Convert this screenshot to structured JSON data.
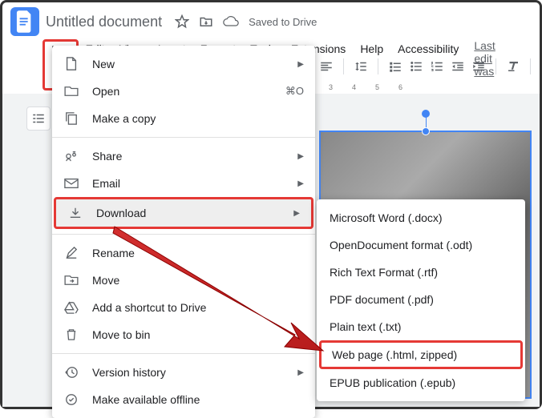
{
  "header": {
    "title": "Untitled document",
    "saved_status": "Saved to Drive"
  },
  "menubar": {
    "items": [
      "File",
      "Edit",
      "View",
      "Insert",
      "Format",
      "Tools",
      "Extensions",
      "Help",
      "Accessibility"
    ],
    "last_edit": "Last edit was s"
  },
  "file_menu": {
    "new": "New",
    "open": "Open",
    "open_shortcut": "⌘O",
    "make_copy": "Make a copy",
    "share": "Share",
    "email": "Email",
    "download": "Download",
    "rename": "Rename",
    "move": "Move",
    "add_shortcut": "Add a shortcut to Drive",
    "move_to_bin": "Move to bin",
    "version_history": "Version history",
    "make_offline": "Make available offline"
  },
  "download_submenu": {
    "items": [
      "Microsoft Word (.docx)",
      "OpenDocument format (.odt)",
      "Rich Text Format (.rtf)",
      "PDF document (.pdf)",
      "Plain text (.txt)",
      "Web page (.html, zipped)",
      "EPUB publication (.epub)"
    ]
  },
  "ruler": {
    "marks": [
      "3",
      "4",
      "5",
      "6"
    ]
  }
}
